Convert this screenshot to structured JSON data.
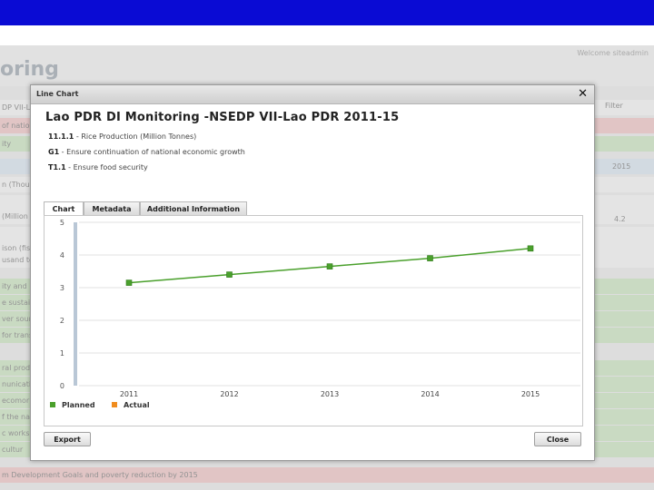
{
  "background": {
    "welcome_text": "Welcome siteadmin",
    "page_title": "oring",
    "tab_label": "DP VII-L",
    "filter_label": "Filter",
    "year_col": "2015",
    "cell_a": "4.2",
    "rows": [
      {
        "text": "of nation"
      },
      {
        "text": "ity"
      },
      {
        "text": ""
      },
      {
        "text": "n (Thou"
      },
      {
        "text": ""
      },
      {
        "text": "(Million"
      },
      {
        "text": ""
      },
      {
        "text": "ison (fish"
      },
      {
        "text": "usand to"
      },
      {
        "text": "ity and"
      },
      {
        "text": "e sustain"
      },
      {
        "text": "ver sour"
      },
      {
        "text": "for trans"
      },
      {
        "text": "ral prod"
      },
      {
        "text": "nunicatio"
      },
      {
        "text": "ecomor"
      },
      {
        "text": "f the na"
      },
      {
        "text": "c works"
      },
      {
        "text": "cultur"
      },
      {
        "text": "m Development Goals and poverty reduction by 2015"
      }
    ]
  },
  "dialog": {
    "title": "Line Chart",
    "close_symbol": "✕",
    "heading": "Lao PDR DI Monitoring -NSEDP VII-Lao PDR 2011-15",
    "indicators": [
      {
        "code": "11.1.1",
        "text": " - Rice Production (Million Tonnes)"
      },
      {
        "code": "G1",
        "text": " - Ensure continuation of national economic growth"
      },
      {
        "code": "T1.1",
        "text": " - Ensure food security"
      }
    ],
    "tabs": [
      {
        "label": "Chart"
      },
      {
        "label": "Metadata"
      },
      {
        "label": "Additional Information"
      }
    ],
    "export_label": "Export",
    "close_label": "Close"
  },
  "chart_data": {
    "type": "line",
    "x": [
      "2011",
      "2012",
      "2013",
      "2014",
      "2015"
    ],
    "series": [
      {
        "name": "Planned",
        "values": [
          3.15,
          3.4,
          3.65,
          3.9,
          4.2
        ],
        "color": "#4aa02c"
      },
      {
        "name": "Actual",
        "values": [],
        "color": "#f08c1e"
      }
    ],
    "yticks": [
      0,
      1,
      2,
      3,
      4,
      5
    ],
    "ylim": [
      0,
      5
    ],
    "grid": true,
    "legend_placement": "bottom-left"
  }
}
